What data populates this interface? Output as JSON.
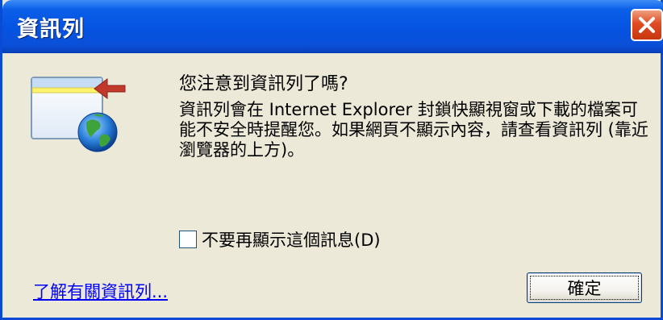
{
  "window": {
    "title": "資訊列"
  },
  "dialog": {
    "question": "您注意到資訊列了嗎?",
    "body": "資訊列會在 Internet Explorer 封鎖快顯視窗或下載的檔案可能不安全時提醒您。如果網頁不顯示內容，請查看資訊列 (靠近瀏覽器的上方)。",
    "checkbox_label": "不要再顯示這個訊息(D)",
    "checkbox_checked": false,
    "link_text": "了解有關資訊列...",
    "ok_label": "確定"
  },
  "colors": {
    "titlebar": "#0554e2",
    "background": "#ece9d8",
    "link": "#0000ff",
    "arrow": "#c0392b"
  },
  "icons": {
    "close": "close-icon",
    "info": "information-bar-icon"
  }
}
